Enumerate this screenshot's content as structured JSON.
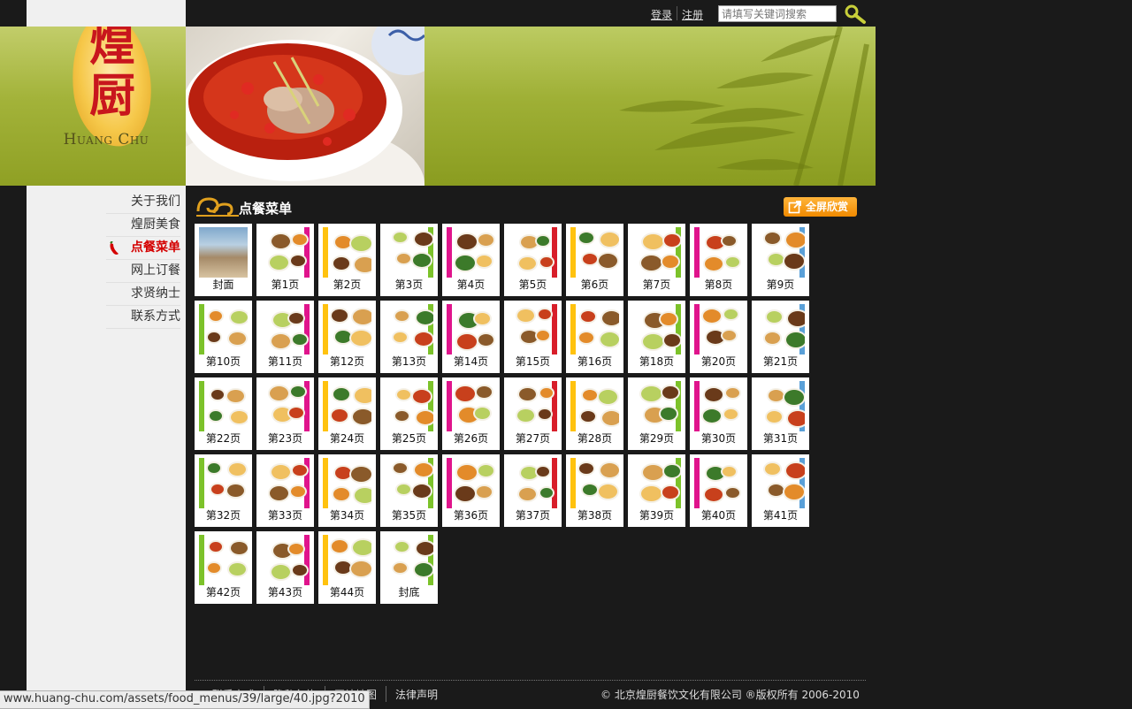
{
  "topbar": {
    "login": "登录",
    "register": "注册",
    "search_placeholder": "请填写关键词搜索"
  },
  "logo": {
    "cn": "煌厨",
    "en": "Huang Chu"
  },
  "nav": {
    "items": [
      {
        "label": "关于我们",
        "active": false
      },
      {
        "label": "煌厨美食",
        "active": false
      },
      {
        "label": "点餐菜单",
        "active": true
      },
      {
        "label": "网上订餐",
        "active": false
      },
      {
        "label": "求贤纳士",
        "active": false
      },
      {
        "label": "联系方式",
        "active": false
      }
    ]
  },
  "section": {
    "title": "点餐菜单",
    "fullscreen": "全屏欣赏"
  },
  "pages": [
    "封面",
    "第1页",
    "第2页",
    "第3页",
    "第4页",
    "第5页",
    "第6页",
    "第7页",
    "第8页",
    "第9页",
    "第10页",
    "第11页",
    "第12页",
    "第13页",
    "第14页",
    "第15页",
    "第16页",
    "第18页",
    "第20页",
    "第21页",
    "第22页",
    "第23页",
    "第24页",
    "第25页",
    "第26页",
    "第27页",
    "第28页",
    "第29页",
    "第30页",
    "第31页",
    "第32页",
    "第33页",
    "第34页",
    "第35页",
    "第36页",
    "第37页",
    "第38页",
    "第39页",
    "第40页",
    "第41页",
    "第42页",
    "第43页",
    "第44页",
    "封底"
  ],
  "footer": {
    "links": [
      "联系方式",
      "隐私条款",
      "网站地图",
      "法律声明"
    ],
    "copyright": "© 北京煌厨餐饮文化有限公司 ®版权所有 2006-2010"
  },
  "status": {
    "url": "www.huang-chu.com/assets/food_menus/39/large/40.jpg?2010"
  },
  "colors": {
    "brand_green": "#9fb036",
    "accent_orange": "#f08a00",
    "active_red": "#d40000",
    "background": "#1a1a1a"
  }
}
